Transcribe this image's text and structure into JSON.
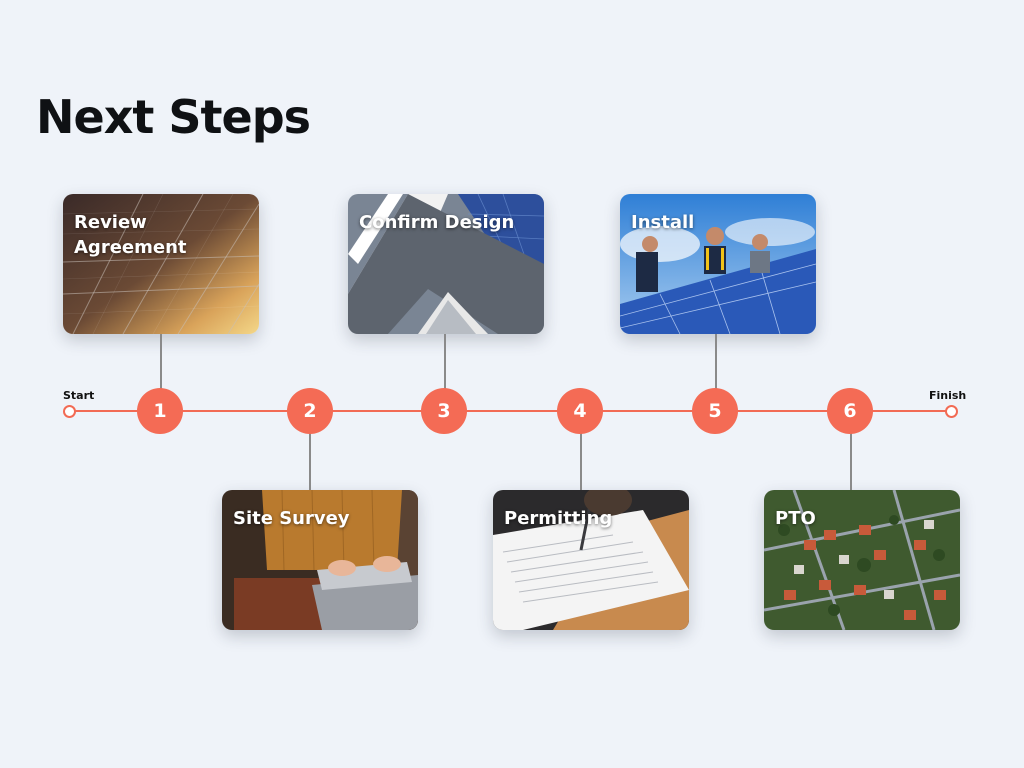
{
  "page": {
    "title": "Next Steps"
  },
  "timeline": {
    "start_label": "Start",
    "finish_label": "Finish",
    "accent_color": "#f26b55"
  },
  "steps": [
    {
      "number": "1",
      "label": "Review Agreement",
      "image": "solar-panel-closeup-sunset"
    },
    {
      "number": "2",
      "label": "Site Survey",
      "image": "person-typing-on-laptop"
    },
    {
      "number": "3",
      "label": "Confirm Design",
      "image": "house-roof-with-solar-panels"
    },
    {
      "number": "4",
      "label": "Permitting",
      "image": "signing-document"
    },
    {
      "number": "5",
      "label": "Install",
      "image": "workers-installing-solar-panels"
    },
    {
      "number": "6",
      "label": "PTO",
      "image": "aerial-neighborhood-view"
    }
  ]
}
